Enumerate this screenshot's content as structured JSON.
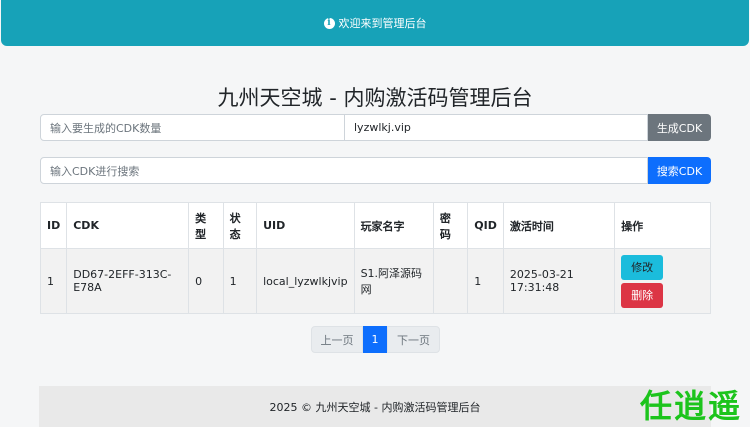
{
  "alert": {
    "icon": "info-circle-icon",
    "text": "欢迎来到管理后台"
  },
  "page_title": "九州天空城 - 内购激活码管理后台",
  "generate": {
    "count_placeholder": "输入要生成的CDK数量",
    "domain_value": "lyzwlkj.vip",
    "button_label": "生成CDK"
  },
  "search": {
    "placeholder": "输入CDK进行搜索",
    "button_label": "搜索CDK"
  },
  "table": {
    "headers": [
      "ID",
      "CDK",
      "类型",
      "状态",
      "UID",
      "玩家名字",
      "密码",
      "QID",
      "激活时间",
      "操作"
    ],
    "rows": [
      {
        "id": "1",
        "cdk": "DD67-2EFF-313C-E78A",
        "type": "0",
        "status": "1",
        "uid": "local_lyzwlkjvip",
        "player_name": "S1.阿泽源码网",
        "password": "",
        "qid": "1",
        "activated_at": "2025-03-21 17:31:48",
        "edit_label": "修改",
        "delete_label": "删除"
      }
    ]
  },
  "pagination": {
    "prev": "上一页",
    "current": "1",
    "next": "下一页"
  },
  "footer": "2025 © 九州天空城 - 内购激活码管理后台",
  "watermark": "任逍遥",
  "colors": {
    "alert": "#17a2b8",
    "primary": "#0d6efd",
    "secondary": "#6c757d",
    "danger": "#dc3545",
    "info": "#1bbcdc"
  }
}
